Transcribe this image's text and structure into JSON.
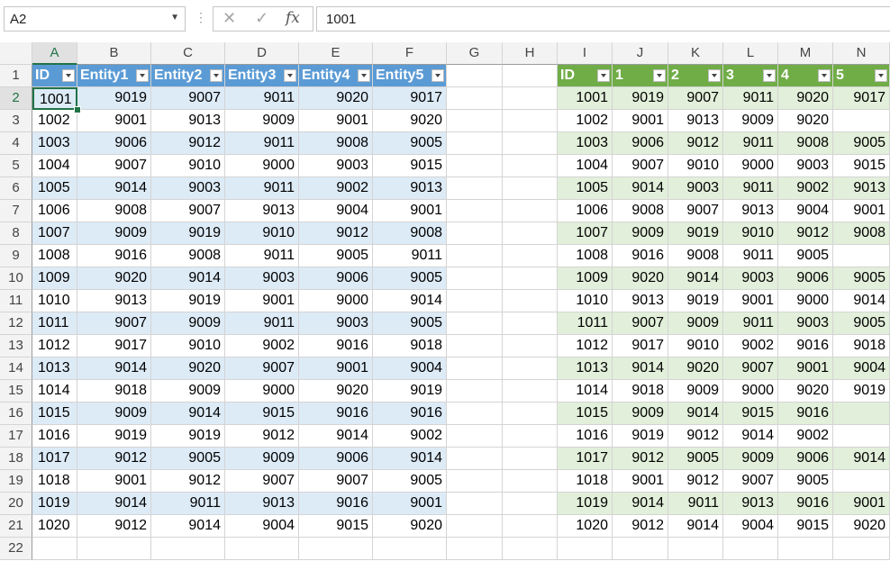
{
  "formula_bar": {
    "name_box": "A2",
    "cancel_icon": "x-icon",
    "enter_icon": "check-icon",
    "function_icon": "fx-icon",
    "function_label": "fx",
    "formula_value": "1001"
  },
  "sheet": {
    "columns": [
      "A",
      "B",
      "C",
      "D",
      "E",
      "F",
      "G",
      "H",
      "I",
      "J",
      "K",
      "L",
      "M",
      "N"
    ],
    "rows": [
      "1",
      "2",
      "3",
      "4",
      "5",
      "6",
      "7",
      "8",
      "9",
      "10",
      "11",
      "12",
      "13",
      "14",
      "15",
      "16",
      "17",
      "18",
      "19",
      "20",
      "21",
      "22"
    ],
    "active_cell": "A2",
    "blue_table": {
      "style_color": "#5b9bd5",
      "headers": [
        "ID",
        "Entity1",
        "Entity2",
        "Entity3",
        "Entity4",
        "Entity5"
      ],
      "rows": [
        [
          "1001",
          "9019",
          "9007",
          "9011",
          "9020",
          "9017"
        ],
        [
          "1002",
          "9001",
          "9013",
          "9009",
          "9001",
          "9020"
        ],
        [
          "1003",
          "9006",
          "9012",
          "9011",
          "9008",
          "9005"
        ],
        [
          "1004",
          "9007",
          "9010",
          "9000",
          "9003",
          "9015"
        ],
        [
          "1005",
          "9014",
          "9003",
          "9011",
          "9002",
          "9013"
        ],
        [
          "1006",
          "9008",
          "9007",
          "9013",
          "9004",
          "9001"
        ],
        [
          "1007",
          "9009",
          "9019",
          "9010",
          "9012",
          "9008"
        ],
        [
          "1008",
          "9016",
          "9008",
          "9011",
          "9005",
          "9011"
        ],
        [
          "1009",
          "9020",
          "9014",
          "9003",
          "9006",
          "9005"
        ],
        [
          "1010",
          "9013",
          "9019",
          "9001",
          "9000",
          "9014"
        ],
        [
          "1011",
          "9007",
          "9009",
          "9011",
          "9003",
          "9005"
        ],
        [
          "1012",
          "9017",
          "9010",
          "9002",
          "9016",
          "9018"
        ],
        [
          "1013",
          "9014",
          "9020",
          "9007",
          "9001",
          "9004"
        ],
        [
          "1014",
          "9018",
          "9009",
          "9000",
          "9020",
          "9019"
        ],
        [
          "1015",
          "9009",
          "9014",
          "9015",
          "9016",
          "9016"
        ],
        [
          "1016",
          "9019",
          "9019",
          "9012",
          "9014",
          "9002"
        ],
        [
          "1017",
          "9012",
          "9005",
          "9009",
          "9006",
          "9014"
        ],
        [
          "1018",
          "9001",
          "9012",
          "9007",
          "9007",
          "9005"
        ],
        [
          "1019",
          "9014",
          "9011",
          "9013",
          "9016",
          "9001"
        ],
        [
          "1020",
          "9012",
          "9014",
          "9004",
          "9015",
          "9020"
        ]
      ]
    },
    "green_table": {
      "style_color": "#70ad47",
      "headers": [
        "ID",
        "1",
        "2",
        "3",
        "4",
        "5"
      ],
      "rows": [
        [
          "1001",
          "9019",
          "9007",
          "9011",
          "9020",
          "9017"
        ],
        [
          "1002",
          "9001",
          "9013",
          "9009",
          "9020",
          ""
        ],
        [
          "1003",
          "9006",
          "9012",
          "9011",
          "9008",
          "9005"
        ],
        [
          "1004",
          "9007",
          "9010",
          "9000",
          "9003",
          "9015"
        ],
        [
          "1005",
          "9014",
          "9003",
          "9011",
          "9002",
          "9013"
        ],
        [
          "1006",
          "9008",
          "9007",
          "9013",
          "9004",
          "9001"
        ],
        [
          "1007",
          "9009",
          "9019",
          "9010",
          "9012",
          "9008"
        ],
        [
          "1008",
          "9016",
          "9008",
          "9011",
          "9005",
          ""
        ],
        [
          "1009",
          "9020",
          "9014",
          "9003",
          "9006",
          "9005"
        ],
        [
          "1010",
          "9013",
          "9019",
          "9001",
          "9000",
          "9014"
        ],
        [
          "1011",
          "9007",
          "9009",
          "9011",
          "9003",
          "9005"
        ],
        [
          "1012",
          "9017",
          "9010",
          "9002",
          "9016",
          "9018"
        ],
        [
          "1013",
          "9014",
          "9020",
          "9007",
          "9001",
          "9004"
        ],
        [
          "1014",
          "9018",
          "9009",
          "9000",
          "9020",
          "9019"
        ],
        [
          "1015",
          "9009",
          "9014",
          "9015",
          "9016",
          ""
        ],
        [
          "1016",
          "9019",
          "9012",
          "9014",
          "9002",
          ""
        ],
        [
          "1017",
          "9012",
          "9005",
          "9009",
          "9006",
          "9014"
        ],
        [
          "1018",
          "9001",
          "9012",
          "9007",
          "9005",
          ""
        ],
        [
          "1019",
          "9014",
          "9011",
          "9013",
          "9016",
          "9001"
        ],
        [
          "1020",
          "9012",
          "9014",
          "9004",
          "9015",
          "9020"
        ]
      ]
    }
  }
}
